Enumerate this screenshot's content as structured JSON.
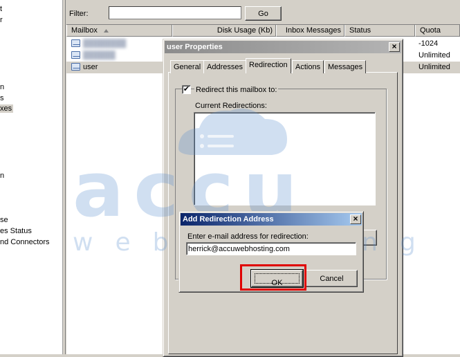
{
  "sidebar": {
    "items": [
      {
        "label": "t",
        "selected": false
      },
      {
        "label": "r",
        "selected": false
      },
      {
        "label": "n",
        "selected": false
      },
      {
        "label": "s",
        "selected": false
      },
      {
        "label": "xes",
        "selected": true
      },
      {
        "label": "n",
        "selected": false
      },
      {
        "label": "se",
        "selected": false
      },
      {
        "label": "es Status",
        "selected": false
      },
      {
        "label": "nd Connectors",
        "selected": false
      }
    ]
  },
  "filter": {
    "label": "Filter:",
    "value": "",
    "go_label": "Go"
  },
  "table": {
    "columns": [
      {
        "label": "Mailbox",
        "sort_icon": "triangle-up-icon"
      },
      {
        "label": "Disk Usage (Kb)"
      },
      {
        "label": "Inbox Messages"
      },
      {
        "label": "Status"
      },
      {
        "label": "Quota"
      }
    ],
    "rows": [
      {
        "mailbox": "",
        "quota": "-1024",
        "selected": false
      },
      {
        "mailbox": "",
        "quota": "Unlimited",
        "selected": false
      },
      {
        "mailbox": "user",
        "quota": "Unlimited",
        "selected": true
      }
    ]
  },
  "properties_dialog": {
    "title": "user Properties",
    "close_icon": "close-icon",
    "tabs": [
      {
        "label": "General",
        "active": false
      },
      {
        "label": "Addresses",
        "active": false
      },
      {
        "label": "Redirection",
        "active": true
      },
      {
        "label": "Actions",
        "active": false
      },
      {
        "label": "Messages",
        "active": false
      }
    ],
    "redirect_checkbox_label": "Redirect this mailbox to:",
    "redirect_checked": true,
    "current_redirections_label": "Current Redirections:"
  },
  "add_redirection_dialog": {
    "title": "Add Redirection Address",
    "prompt": "Enter e-mail address for redirection:",
    "email_value": "herrick@accuwebhosting.com",
    "ok_label": "OK",
    "cancel_label": "Cancel"
  },
  "watermark": {
    "text_top": "accu",
    "text_bottom": "webhosting",
    "color": "#5b8fd0"
  },
  "colors": {
    "highlight": "#e00000",
    "active_title": "#0a246a",
    "inactive_title": "#8c8c8c"
  }
}
